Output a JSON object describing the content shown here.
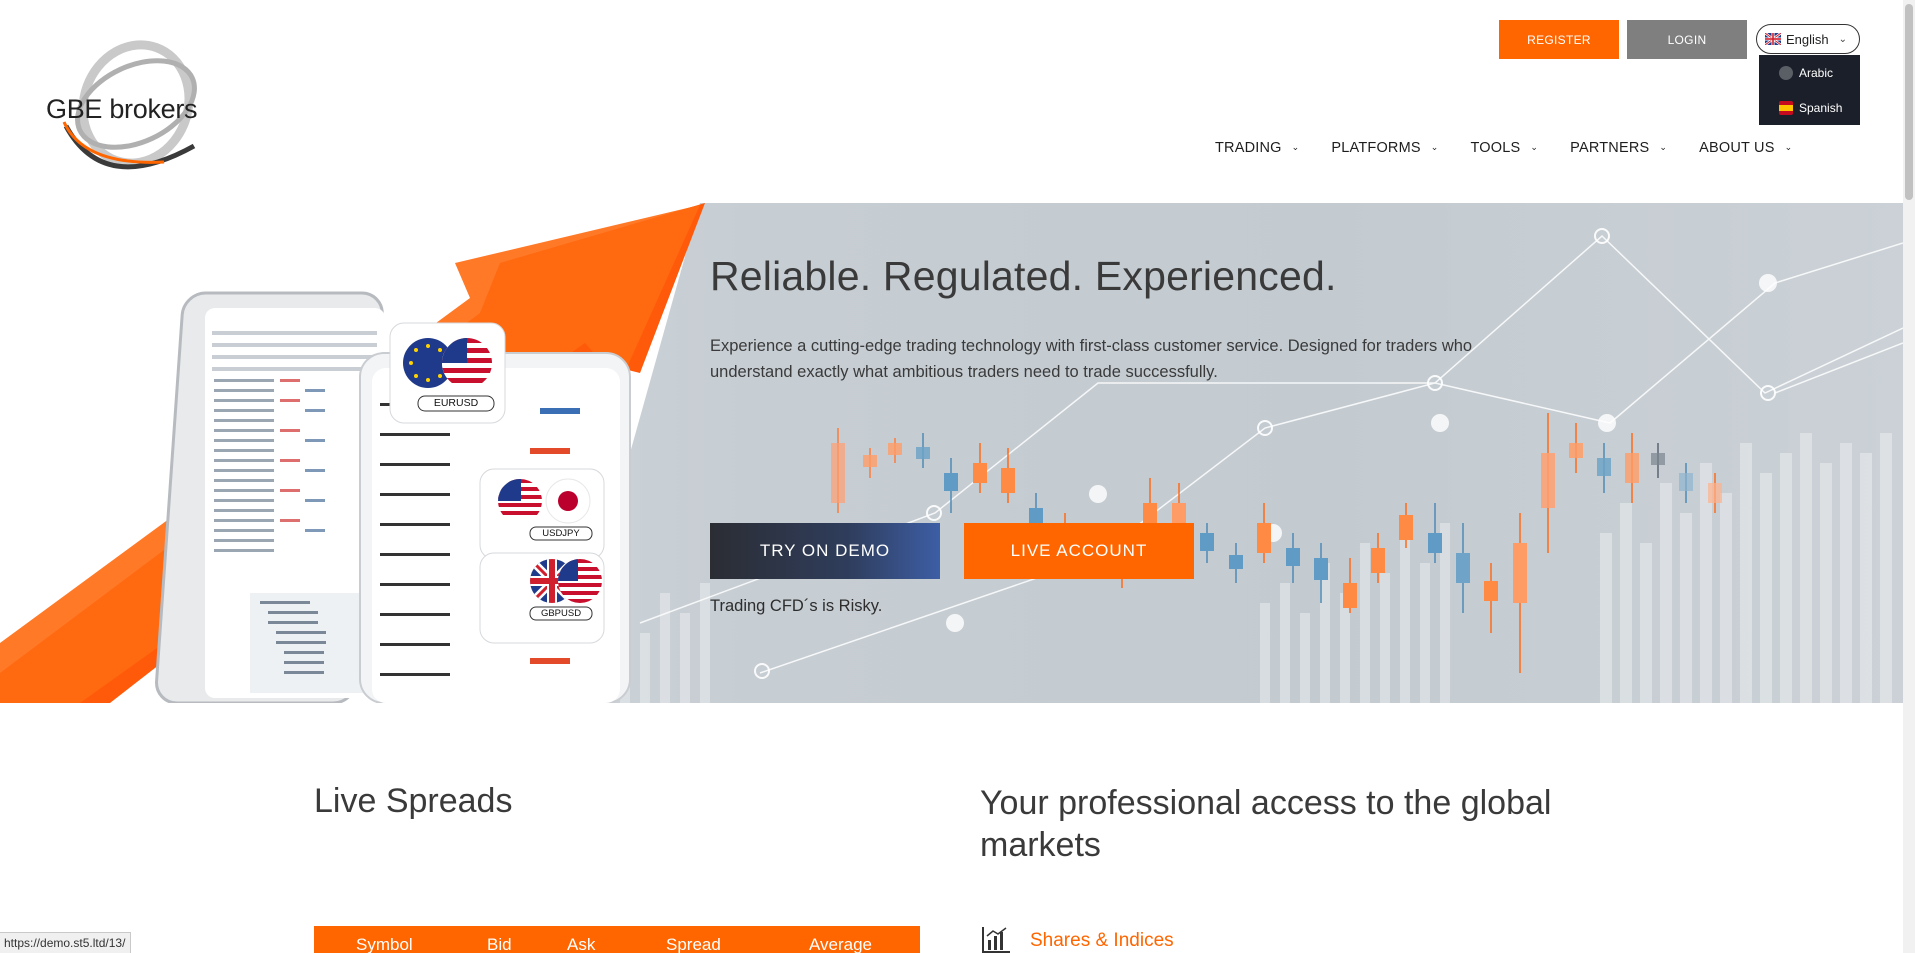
{
  "header": {
    "logo_text": "GBE brokers",
    "register_label": "REGISTER",
    "login_label": "LOGIN",
    "language": {
      "selected": "English",
      "options": [
        "Arabic",
        "Spanish"
      ]
    },
    "nav": [
      {
        "label": "TRADING"
      },
      {
        "label": "PLATFORMS"
      },
      {
        "label": "TOOLS"
      },
      {
        "label": "PARTNERS"
      },
      {
        "label": "ABOUT US"
      }
    ]
  },
  "hero": {
    "title": "Reliable. Regulated. Experienced.",
    "description": "Experience a cutting-edge trading technology with first-class customer service. Designed for traders who understand exactly what ambitious traders need to trade successfully.",
    "demo_button": "TRY ON DEMO",
    "live_button": "LIVE ACCOUNT",
    "risk_text": "Trading CFD´s is Risky.",
    "badges": [
      "EURUSD",
      "USDJPY",
      "GBPUSD"
    ]
  },
  "sections": {
    "live_spreads_title": "Live Spreads",
    "global_markets_title": "Your professional access to the global markets",
    "spreads_columns": [
      "Symbol",
      "Bid",
      "Ask",
      "Spread",
      "Average"
    ],
    "shares_link": "Shares & Indices"
  },
  "status_bar": {
    "url": "https://demo.st5.ltd/13/"
  },
  "colors": {
    "accent": "#ff6600",
    "login_grey": "#7f7f7f",
    "dropdown_bg": "#1a1f29"
  }
}
